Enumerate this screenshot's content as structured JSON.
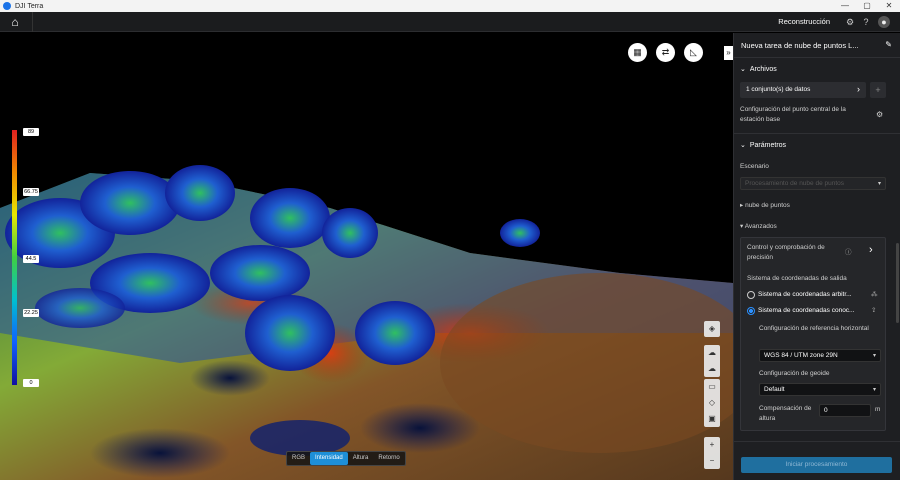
{
  "window": {
    "app_title": "DJI Terra",
    "min": "—",
    "max": "▢",
    "close": "✕"
  },
  "topbar": {
    "mode_label": "Reconstrucción"
  },
  "legend": {
    "ticks": [
      "0",
      "22.25",
      "44.5",
      "66.75",
      "89"
    ]
  },
  "viewer_modes": {
    "options": [
      "RGB",
      "Intensidad",
      "Altura",
      "Retorno"
    ],
    "selected": "Intensidad"
  },
  "panel": {
    "title": "Nueva tarea de nube de puntos L...",
    "files": {
      "heading": "Archivos",
      "dataset_button": "1 conjunto(s) de datos",
      "base_station_label": "Configuración del punto central de la estación base"
    },
    "params": {
      "heading": "Parámetros",
      "scenario_label": "Escenario",
      "scenario_value": "Procesamiento de nube de puntos",
      "point_cloud_label": "nube de puntos",
      "advanced_label": "Avanzados",
      "precision_label": "Control y comprobación de precisión",
      "output_cs_label": "Sistema de coordenadas de salida",
      "cs_arbitrary": "Sistema de coordenadas arbitr...",
      "cs_known": "Sistema de coordenadas conoc...",
      "horizontal_ref_label": "Configuración de referencia horizontal",
      "horizontal_ref_value": "WGS 84 / UTM zone 29N",
      "geoid_label": "Configuración de geoide",
      "geoid_value": "Default",
      "height_comp_label": "Compensación de altura",
      "height_comp_value": "0",
      "height_comp_unit": "m"
    },
    "start_button": "Iniciar procesamiento"
  }
}
